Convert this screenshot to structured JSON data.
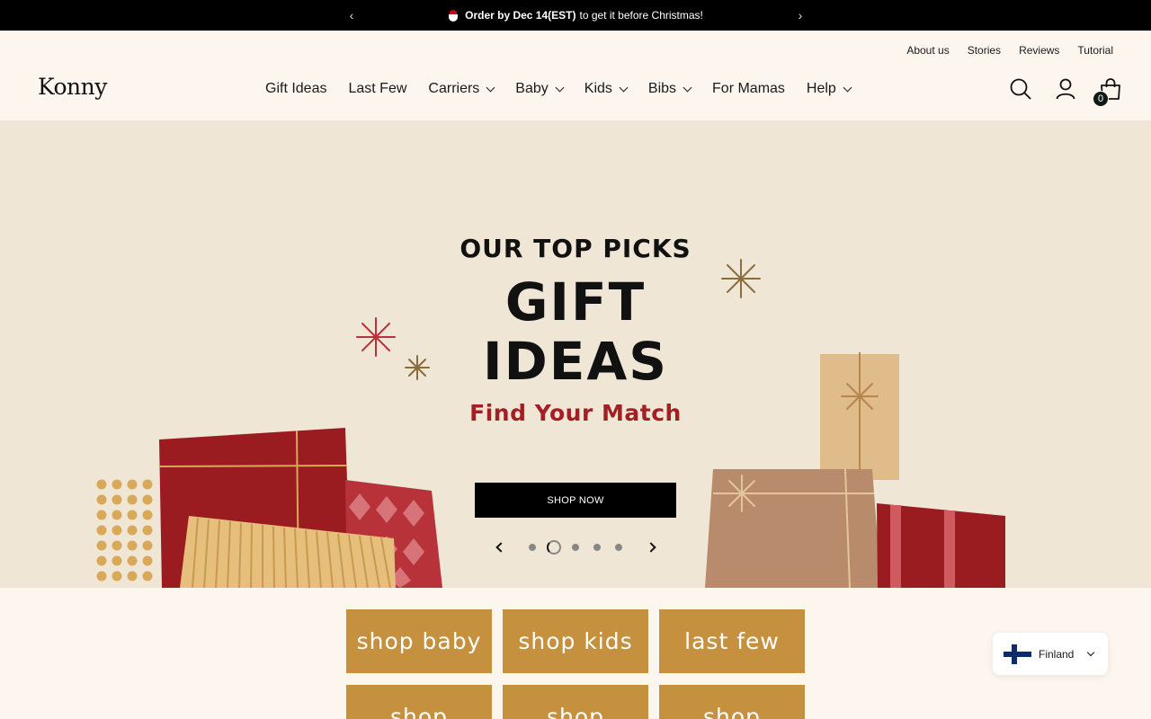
{
  "announcement": {
    "prefix_bold": "Order by Dec 14(EST)",
    "suffix": "to get it before Christmas!"
  },
  "header": {
    "logo": "Konny",
    "util_nav": [
      "About us",
      "Stories",
      "Reviews",
      "Tutorial"
    ],
    "main_nav": [
      {
        "label": "Gift Ideas",
        "dropdown": false
      },
      {
        "label": "Last Few",
        "dropdown": false
      },
      {
        "label": "Carriers",
        "dropdown": true
      },
      {
        "label": "Baby",
        "dropdown": true
      },
      {
        "label": "Kids",
        "dropdown": true
      },
      {
        "label": "Bibs",
        "dropdown": true
      },
      {
        "label": "For Mamas",
        "dropdown": false
      },
      {
        "label": "Help",
        "dropdown": true
      }
    ],
    "cart_count": "0"
  },
  "hero": {
    "line1": "OUR TOP PICKS",
    "line2": "GIFT",
    "line3": "IDEAS",
    "line4": "Find Your Match",
    "cta": "SHOP NOW",
    "slide_count": 5,
    "active_slide": 2
  },
  "categories": [
    {
      "label": "shop baby"
    },
    {
      "label": "shop kids"
    },
    {
      "label": "last few"
    },
    {
      "label": "shop"
    },
    {
      "label": "shop"
    },
    {
      "label": "shop"
    }
  ],
  "country": {
    "label": "Finland"
  },
  "colors": {
    "page_bg": "#fcf6ee",
    "hero_bg": "#f0e6d6",
    "accent_red": "#a31f24",
    "category_gold": "#c6913f"
  }
}
